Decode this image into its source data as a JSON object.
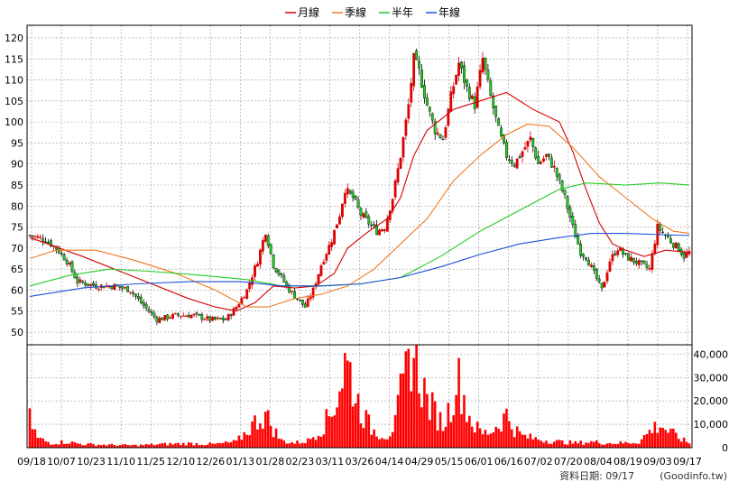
{
  "chart_data": {
    "type": "candlestick",
    "legend": [
      {
        "name": "月線",
        "color": "#d40000"
      },
      {
        "name": "季線",
        "color": "#f07820"
      },
      {
        "name": "半年",
        "color": "#22cc22"
      },
      {
        "name": "年線",
        "color": "#1a50d8"
      }
    ],
    "price_axis": {
      "ticks": [
        50,
        55,
        60,
        65,
        70,
        75,
        80,
        85,
        90,
        95,
        100,
        105,
        110,
        115,
        120
      ],
      "range": [
        47,
        123
      ]
    },
    "volume_axis": {
      "ticks": [
        0,
        10000,
        20000,
        30000,
        40000
      ],
      "tick_labels": [
        "0",
        "10,000",
        "20,000",
        "30,000",
        "40,000"
      ],
      "range": [
        0,
        44000
      ]
    },
    "date_labels": [
      "09/18",
      "10/07",
      "10/23",
      "11/10",
      "11/25",
      "12/10",
      "12/26",
      "01/13",
      "01/28",
      "02/23",
      "03/11",
      "03/26",
      "04/14",
      "04/29",
      "05/15",
      "06/01",
      "06/16",
      "07/02",
      "07/20",
      "08/04",
      "08/19",
      "09/03",
      "09/17"
    ],
    "price_keypoints": [
      [
        0,
        73
      ],
      [
        6,
        72
      ],
      [
        10,
        70
      ],
      [
        14,
        67
      ],
      [
        18,
        62
      ],
      [
        25,
        61
      ],
      [
        32,
        61
      ],
      [
        38,
        60
      ],
      [
        42,
        57
      ],
      [
        48,
        53
      ],
      [
        55,
        54
      ],
      [
        62,
        54
      ],
      [
        68,
        53
      ],
      [
        74,
        53
      ],
      [
        78,
        56
      ],
      [
        82,
        60
      ],
      [
        86,
        67
      ],
      [
        89,
        74
      ],
      [
        92,
        66
      ],
      [
        95,
        63
      ],
      [
        98,
        60
      ],
      [
        101,
        58
      ],
      [
        104,
        56
      ],
      [
        107,
        60
      ],
      [
        110,
        66
      ],
      [
        114,
        72
      ],
      [
        117,
        78
      ],
      [
        119,
        84
      ],
      [
        122,
        82
      ],
      [
        125,
        78
      ],
      [
        128,
        76
      ],
      [
        131,
        74
      ],
      [
        134,
        75
      ],
      [
        137,
        82
      ],
      [
        140,
        92
      ],
      [
        143,
        104
      ],
      [
        145,
        115
      ],
      [
        147,
        112
      ],
      [
        150,
        104
      ],
      [
        153,
        98
      ],
      [
        156,
        96
      ],
      [
        159,
        106
      ],
      [
        162,
        114
      ],
      [
        165,
        108
      ],
      [
        168,
        104
      ],
      [
        171,
        115
      ],
      [
        174,
        106
      ],
      [
        177,
        98
      ],
      [
        180,
        92
      ],
      [
        183,
        90
      ],
      [
        186,
        93
      ],
      [
        189,
        96
      ],
      [
        192,
        90
      ],
      [
        195,
        92
      ],
      [
        198,
        89
      ],
      [
        202,
        82
      ],
      [
        205,
        75
      ],
      [
        208,
        69
      ],
      [
        210,
        68
      ],
      [
        213,
        64
      ],
      [
        216,
        60
      ],
      [
        219,
        67
      ],
      [
        222,
        70
      ],
      [
        225,
        68
      ],
      [
        228,
        67
      ],
      [
        231,
        66
      ],
      [
        234,
        65
      ],
      [
        237,
        75
      ],
      [
        240,
        73
      ],
      [
        243,
        71
      ],
      [
        245,
        70
      ],
      [
        247,
        68
      ],
      [
        249,
        69
      ]
    ],
    "volume_keypoints": [
      [
        0,
        12000
      ],
      [
        3,
        4000
      ],
      [
        8,
        2000
      ],
      [
        14,
        2500
      ],
      [
        20,
        1500
      ],
      [
        30,
        1200
      ],
      [
        40,
        1000
      ],
      [
        50,
        1500
      ],
      [
        60,
        1800
      ],
      [
        70,
        1500
      ],
      [
        78,
        2500
      ],
      [
        82,
        7000
      ],
      [
        86,
        12000
      ],
      [
        89,
        14000
      ],
      [
        92,
        8000
      ],
      [
        95,
        3000
      ],
      [
        100,
        2000
      ],
      [
        105,
        3000
      ],
      [
        110,
        8000
      ],
      [
        114,
        15000
      ],
      [
        117,
        26000
      ],
      [
        119,
        36000
      ],
      [
        121,
        32000
      ],
      [
        123,
        22000
      ],
      [
        126,
        14000
      ],
      [
        129,
        8000
      ],
      [
        132,
        6000
      ],
      [
        135,
        5000
      ],
      [
        138,
        10000
      ],
      [
        140,
        22000
      ],
      [
        142,
        30000
      ],
      [
        144,
        42000
      ],
      [
        146,
        36000
      ],
      [
        148,
        28000
      ],
      [
        150,
        20000
      ],
      [
        153,
        15000
      ],
      [
        156,
        10000
      ],
      [
        159,
        18000
      ],
      [
        161,
        30000
      ],
      [
        163,
        26000
      ],
      [
        165,
        16000
      ],
      [
        168,
        9000
      ],
      [
        171,
        6000
      ],
      [
        174,
        7000
      ],
      [
        177,
        10000
      ],
      [
        180,
        14000
      ],
      [
        183,
        8000
      ],
      [
        186,
        5000
      ],
      [
        190,
        4000
      ],
      [
        196,
        3000
      ],
      [
        200,
        2500
      ],
      [
        206,
        2000
      ],
      [
        212,
        2500
      ],
      [
        218,
        2000
      ],
      [
        224,
        2000
      ],
      [
        230,
        2500
      ],
      [
        235,
        8000
      ],
      [
        238,
        10000
      ],
      [
        241,
        7000
      ],
      [
        244,
        5000
      ],
      [
        247,
        3000
      ],
      [
        249,
        2000
      ]
    ],
    "ma_lines": [
      {
        "name": "月線",
        "color": "#d40000",
        "points": [
          [
            0,
            72.5
          ],
          [
            20,
            68
          ],
          [
            40,
            63
          ],
          [
            60,
            58
          ],
          [
            70,
            56
          ],
          [
            78,
            55
          ],
          [
            85,
            57
          ],
          [
            92,
            61
          ],
          [
            100,
            60.5
          ],
          [
            108,
            61
          ],
          [
            115,
            64
          ],
          [
            120,
            70
          ],
          [
            128,
            74
          ],
          [
            135,
            77
          ],
          [
            140,
            82
          ],
          [
            145,
            92
          ],
          [
            150,
            98
          ],
          [
            160,
            103
          ],
          [
            170,
            105
          ],
          [
            180,
            107
          ],
          [
            190,
            103
          ],
          [
            200,
            100
          ],
          [
            205,
            93
          ],
          [
            210,
            84
          ],
          [
            215,
            76
          ],
          [
            220,
            71
          ],
          [
            225,
            69.5
          ],
          [
            232,
            68
          ],
          [
            240,
            69.5
          ],
          [
            249,
            69
          ]
        ]
      },
      {
        "name": "季線",
        "color": "#f07820",
        "points": [
          [
            0,
            67.5
          ],
          [
            10,
            69.5
          ],
          [
            25,
            69.5
          ],
          [
            40,
            67
          ],
          [
            55,
            64
          ],
          [
            70,
            60
          ],
          [
            82,
            56
          ],
          [
            90,
            56
          ],
          [
            100,
            58
          ],
          [
            110,
            59
          ],
          [
            120,
            61
          ],
          [
            130,
            65
          ],
          [
            140,
            71
          ],
          [
            150,
            77
          ],
          [
            160,
            86
          ],
          [
            170,
            92
          ],
          [
            180,
            97
          ],
          [
            188,
            99.5
          ],
          [
            196,
            99
          ],
          [
            205,
            94
          ],
          [
            215,
            87
          ],
          [
            225,
            82
          ],
          [
            235,
            77
          ],
          [
            243,
            74
          ],
          [
            249,
            73.5
          ]
        ]
      },
      {
        "name": "半年",
        "color": "#22cc22",
        "points": [
          [
            0,
            61
          ],
          [
            15,
            63.5
          ],
          [
            30,
            65
          ],
          [
            45,
            64.5
          ],
          [
            65,
            63.5
          ],
          [
            82,
            62.5
          ],
          [
            95,
            61
          ],
          [
            110,
            61
          ],
          [
            125,
            61.5
          ],
          [
            140,
            63
          ],
          [
            155,
            68
          ],
          [
            170,
            74
          ],
          [
            185,
            79
          ],
          [
            200,
            84
          ],
          [
            210,
            85.5
          ],
          [
            225,
            85
          ],
          [
            238,
            85.5
          ],
          [
            249,
            85
          ]
        ]
      },
      {
        "name": "年線",
        "color": "#1a50d8",
        "points": [
          [
            0,
            58.5
          ],
          [
            20,
            60.5
          ],
          [
            40,
            61.5
          ],
          [
            60,
            62
          ],
          [
            80,
            62
          ],
          [
            95,
            61
          ],
          [
            110,
            61
          ],
          [
            125,
            61.5
          ],
          [
            140,
            63
          ],
          [
            155,
            65.5
          ],
          [
            170,
            68.5
          ],
          [
            185,
            71
          ],
          [
            200,
            72.5
          ],
          [
            212,
            73.5
          ],
          [
            225,
            73.5
          ],
          [
            238,
            73.2
          ],
          [
            249,
            73
          ]
        ]
      }
    ],
    "footer_note": "資料日期: 09/17",
    "source_note": "(Goodinfo.tw)"
  }
}
